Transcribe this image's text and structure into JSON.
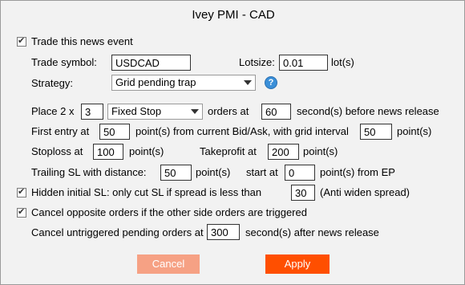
{
  "dialog": {
    "title": "Ivey PMI - CAD"
  },
  "trade_event": {
    "label": "Trade this news event",
    "checked": true
  },
  "symbol": {
    "label": "Trade symbol:",
    "value": "USDCAD"
  },
  "lotsize": {
    "label": "Lotsize:",
    "value": "0.01",
    "unit": "lot(s)"
  },
  "strategy": {
    "label": "Strategy:",
    "selected": "Grid pending trap",
    "help_icon": "help-icon"
  },
  "place": {
    "prefix": "Place 2 x",
    "count": "3",
    "order_type": "Fixed Stop",
    "orders_at": "orders at",
    "seconds": "60",
    "suffix": "second(s) before news release"
  },
  "first_entry": {
    "label": "First entry at",
    "value": "50",
    "middle": "point(s) from current Bid/Ask, with grid interval",
    "interval": "50",
    "unit": "point(s)"
  },
  "stoploss": {
    "label": "Stoploss at",
    "value": "100",
    "unit": "point(s)"
  },
  "takeprofit": {
    "label": "Takeprofit at",
    "value": "200",
    "unit": "point(s)"
  },
  "trailing": {
    "label": "Trailing SL with distance:",
    "value": "50",
    "unit": "point(s)",
    "start_label": "start at",
    "start_value": "0",
    "start_unit": "point(s) from EP"
  },
  "hidden_sl": {
    "label": "Hidden initial SL:  only cut SL if spread is less than",
    "checked": true,
    "value": "30",
    "suffix": "(Anti widen spread)"
  },
  "cancel_opposite": {
    "label": "Cancel opposite orders if the other side orders are triggered",
    "checked": true
  },
  "cancel_untriggered": {
    "label": "Cancel untriggered pending orders at",
    "value": "300",
    "suffix": "second(s) after news release"
  },
  "buttons": {
    "cancel": "Cancel",
    "apply": "Apply"
  },
  "colors": {
    "cancel_bg": "#f6a184",
    "apply_bg": "#ff4f00"
  }
}
